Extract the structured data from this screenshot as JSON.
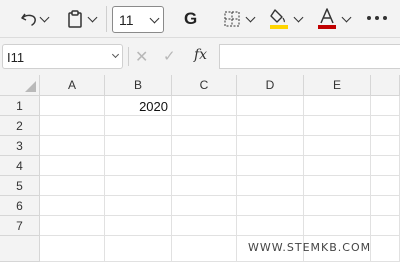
{
  "toolbar": {
    "font_size": "11",
    "bold_label": "G",
    "more_label": "More options",
    "fill_color": "#ffd500",
    "font_color": "#c00000"
  },
  "formula_bar": {
    "name_box": "I11",
    "fx_label": "fx",
    "cancel_glyph": "✕",
    "enter_glyph": "✓",
    "formula": ""
  },
  "sheet": {
    "columns": [
      "A",
      "B",
      "C",
      "D",
      "E"
    ],
    "rows": [
      "1",
      "2",
      "3",
      "4",
      "5",
      "6",
      "7"
    ],
    "cells": {
      "B1": "2020"
    }
  },
  "watermark": "WWW.STEMKB.COM"
}
